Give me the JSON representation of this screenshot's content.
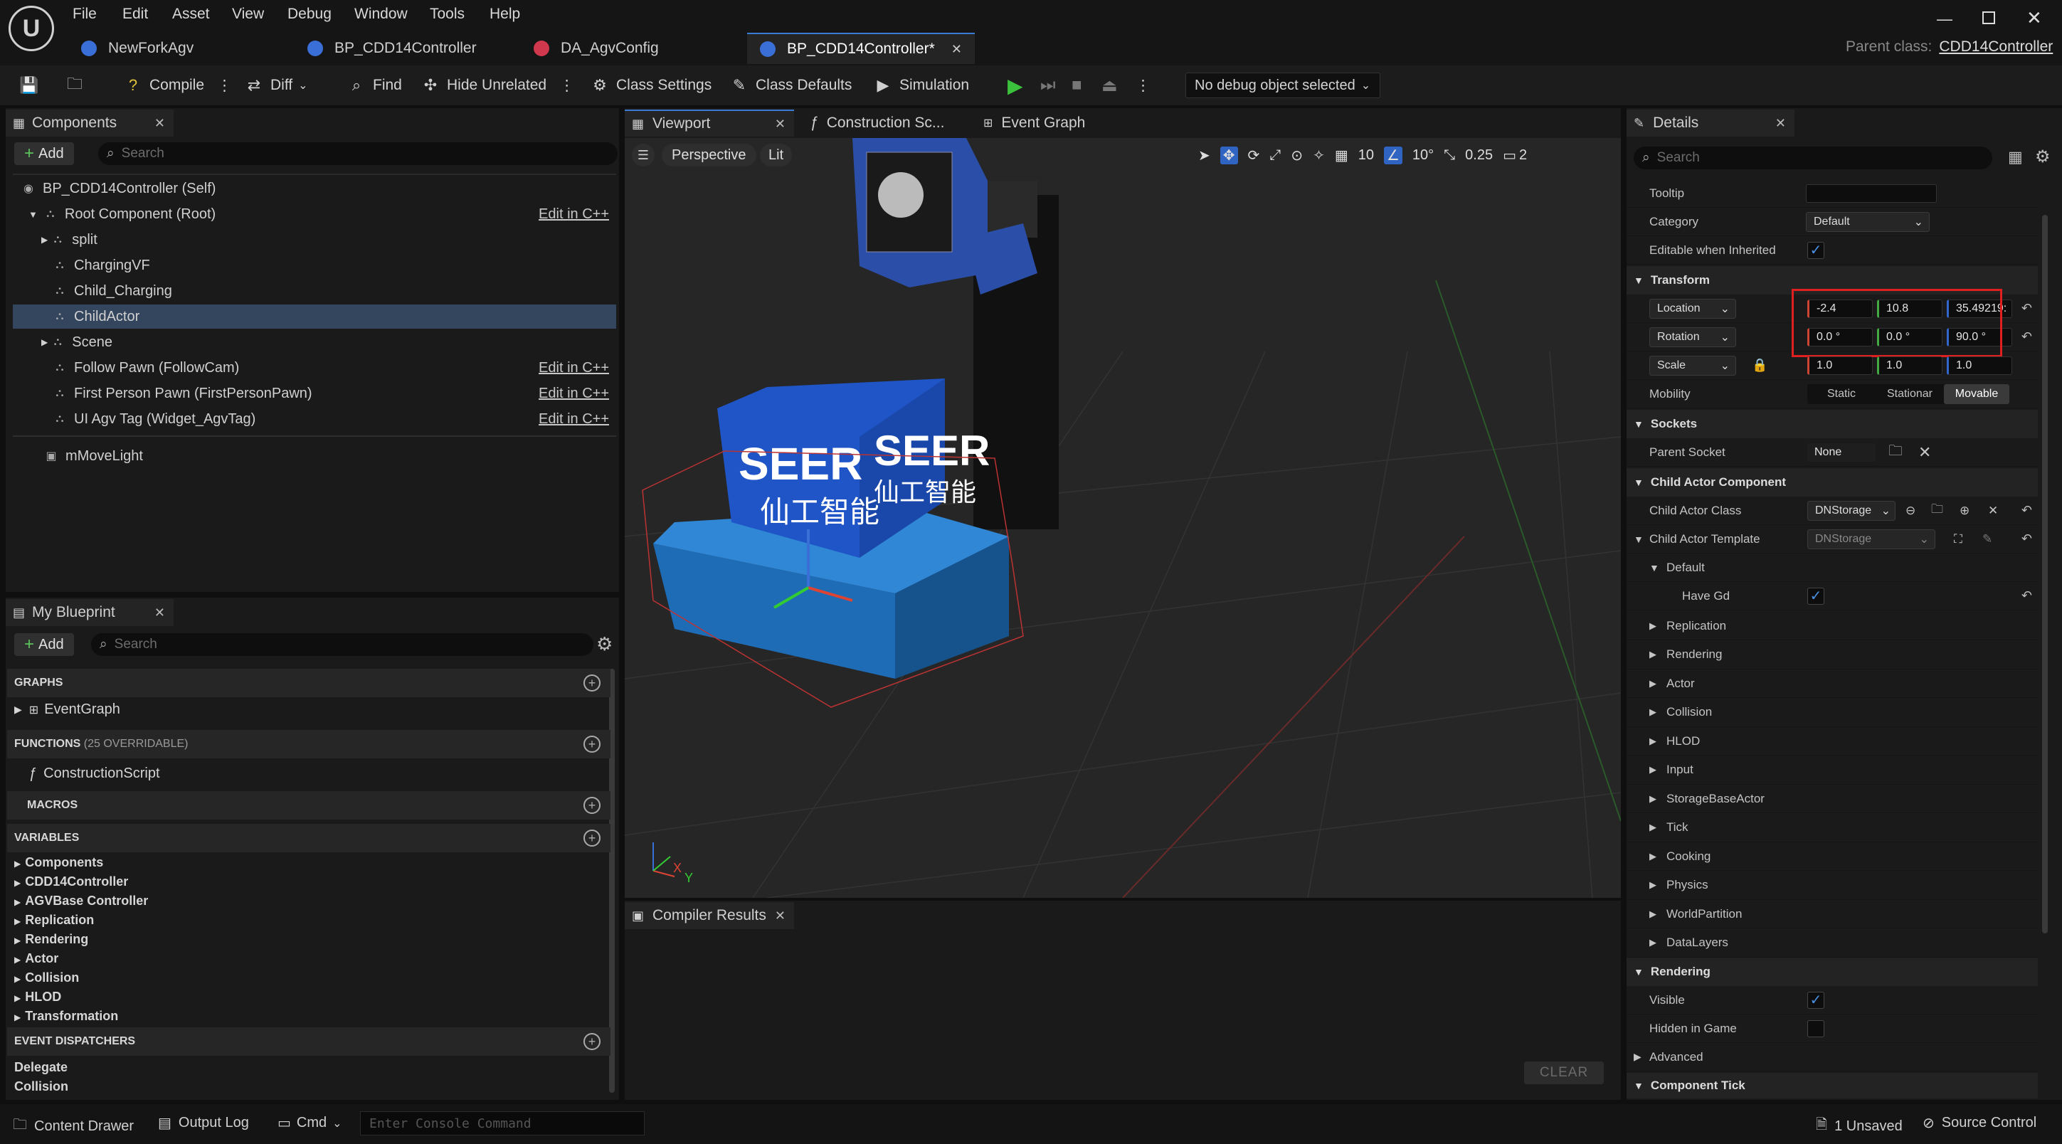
{
  "menu": [
    "File",
    "Edit",
    "Asset",
    "View",
    "Debug",
    "Window",
    "Tools",
    "Help"
  ],
  "tabs": [
    {
      "label": "NewForkAgv",
      "color": "#3a6fd8"
    },
    {
      "label": "BP_CDD14Controller",
      "color": "#3a6fd8"
    },
    {
      "label": "DA_AgvConfig",
      "color": "#d0394d"
    },
    {
      "label": "BP_CDD14Controller*",
      "color": "#3a6fd8",
      "active": true
    }
  ],
  "parent_class": {
    "label": "Parent class:",
    "value": "CDD14Controller"
  },
  "toolbar": {
    "compile": "Compile",
    "diff": "Diff",
    "find": "Find",
    "hide_unrelated": "Hide Unrelated",
    "class_settings": "Class Settings",
    "class_defaults": "Class Defaults",
    "simulation": "Simulation",
    "debug_object": "No debug object selected"
  },
  "components": {
    "tab": "Components",
    "add": "Add",
    "search_placeholder": "Search",
    "rows": [
      {
        "label": "BP_CDD14Controller (Self)",
        "indent": 0,
        "edit": ""
      },
      {
        "label": "Root Component (Root)",
        "indent": 1,
        "edit": "Edit in C++"
      },
      {
        "label": "split",
        "indent": 2,
        "edit": ""
      },
      {
        "label": "ChargingVF",
        "indent": 2,
        "edit": ""
      },
      {
        "label": "Child_Charging",
        "indent": 2,
        "edit": ""
      },
      {
        "label": "ChildActor",
        "indent": 2,
        "edit": "",
        "selected": true
      },
      {
        "label": "Scene",
        "indent": 2,
        "edit": ""
      },
      {
        "label": "Follow Pawn (FollowCam)",
        "indent": 2,
        "edit": "Edit in C++"
      },
      {
        "label": "First Person Pawn (FirstPersonPawn)",
        "indent": 2,
        "edit": "Edit in C++"
      },
      {
        "label": "UI Agv Tag (Widget_AgvTag)",
        "indent": 2,
        "edit": "Edit in C++"
      },
      {
        "label": "mMoveLight",
        "indent": 1,
        "edit": ""
      }
    ]
  },
  "my_blueprint": {
    "tab": "My Blueprint",
    "add": "Add",
    "search_placeholder": "Search",
    "graphs_header": "GRAPHS",
    "graph_item": "EventGraph",
    "functions_header": "FUNCTIONS",
    "functions_note": "(25 OVERRIDABLE)",
    "function_item": "ConstructionScript",
    "macros_header": "MACROS",
    "variables_header": "VARIABLES",
    "variables": [
      "Components",
      "CDD14Controller",
      "AGVBase Controller",
      "Replication",
      "Rendering",
      "Actor",
      "Collision",
      "HLOD",
      "Transformation"
    ],
    "dispatchers_header": "EVENT DISPATCHERS",
    "dispatchers": [
      "Delegate",
      "Collision"
    ]
  },
  "viewport": {
    "tabs": [
      "Viewport",
      "Construction Sc...",
      "Event Graph"
    ],
    "perspective": "Perspective",
    "lit": "Lit",
    "grid": "10",
    "angle": "10°",
    "scale": "0.25",
    "camera": "2",
    "axis_x": "X",
    "axis_y": "Y",
    "logo_text": "SEER",
    "logo_cn": "仙工智能"
  },
  "compiler": {
    "tab": "Compiler Results",
    "clear": "CLEAR"
  },
  "details": {
    "tab": "Details",
    "search_placeholder": "Search",
    "tooltip": "Tooltip",
    "category": "Category",
    "category_value": "Default",
    "editable": "Editable when Inherited",
    "transform": "Transform",
    "location": "Location",
    "location_vals": [
      "-2.4",
      "10.8",
      "35.49219:"
    ],
    "rotation": "Rotation",
    "rotation_vals": [
      "0.0 °",
      "0.0 °",
      "90.0 °"
    ],
    "scale": "Scale",
    "scale_vals": [
      "1.0",
      "1.0",
      "1.0"
    ],
    "mobility": "Mobility",
    "mobility_opts": [
      "Static",
      "Stationar",
      "Movable"
    ],
    "sockets": "Sockets",
    "parent_socket": "Parent Socket",
    "parent_socket_value": "None",
    "child_actor_component": "Child Actor Component",
    "child_actor_class": "Child Actor Class",
    "child_actor_class_value": "DNStorage",
    "child_actor_template": "Child Actor Template",
    "child_actor_template_value": "DNStorage",
    "default": "Default",
    "have_gd": "Have Gd",
    "subcats": [
      "Replication",
      "Rendering",
      "Actor",
      "Collision",
      "HLOD",
      "Input",
      "StorageBaseActor",
      "Tick",
      "Cooking",
      "Physics",
      "WorldPartition",
      "DataLayers"
    ],
    "rendering": "Rendering",
    "visible": "Visible",
    "hidden": "Hidden in Game",
    "advanced": "Advanced",
    "component_tick": "Component Tick"
  },
  "statusbar": {
    "content_drawer": "Content Drawer",
    "output_log": "Output Log",
    "cmd": "Cmd",
    "console_placeholder": "Enter Console Command",
    "unsaved": "1 Unsaved",
    "source_control": "Source Control"
  }
}
